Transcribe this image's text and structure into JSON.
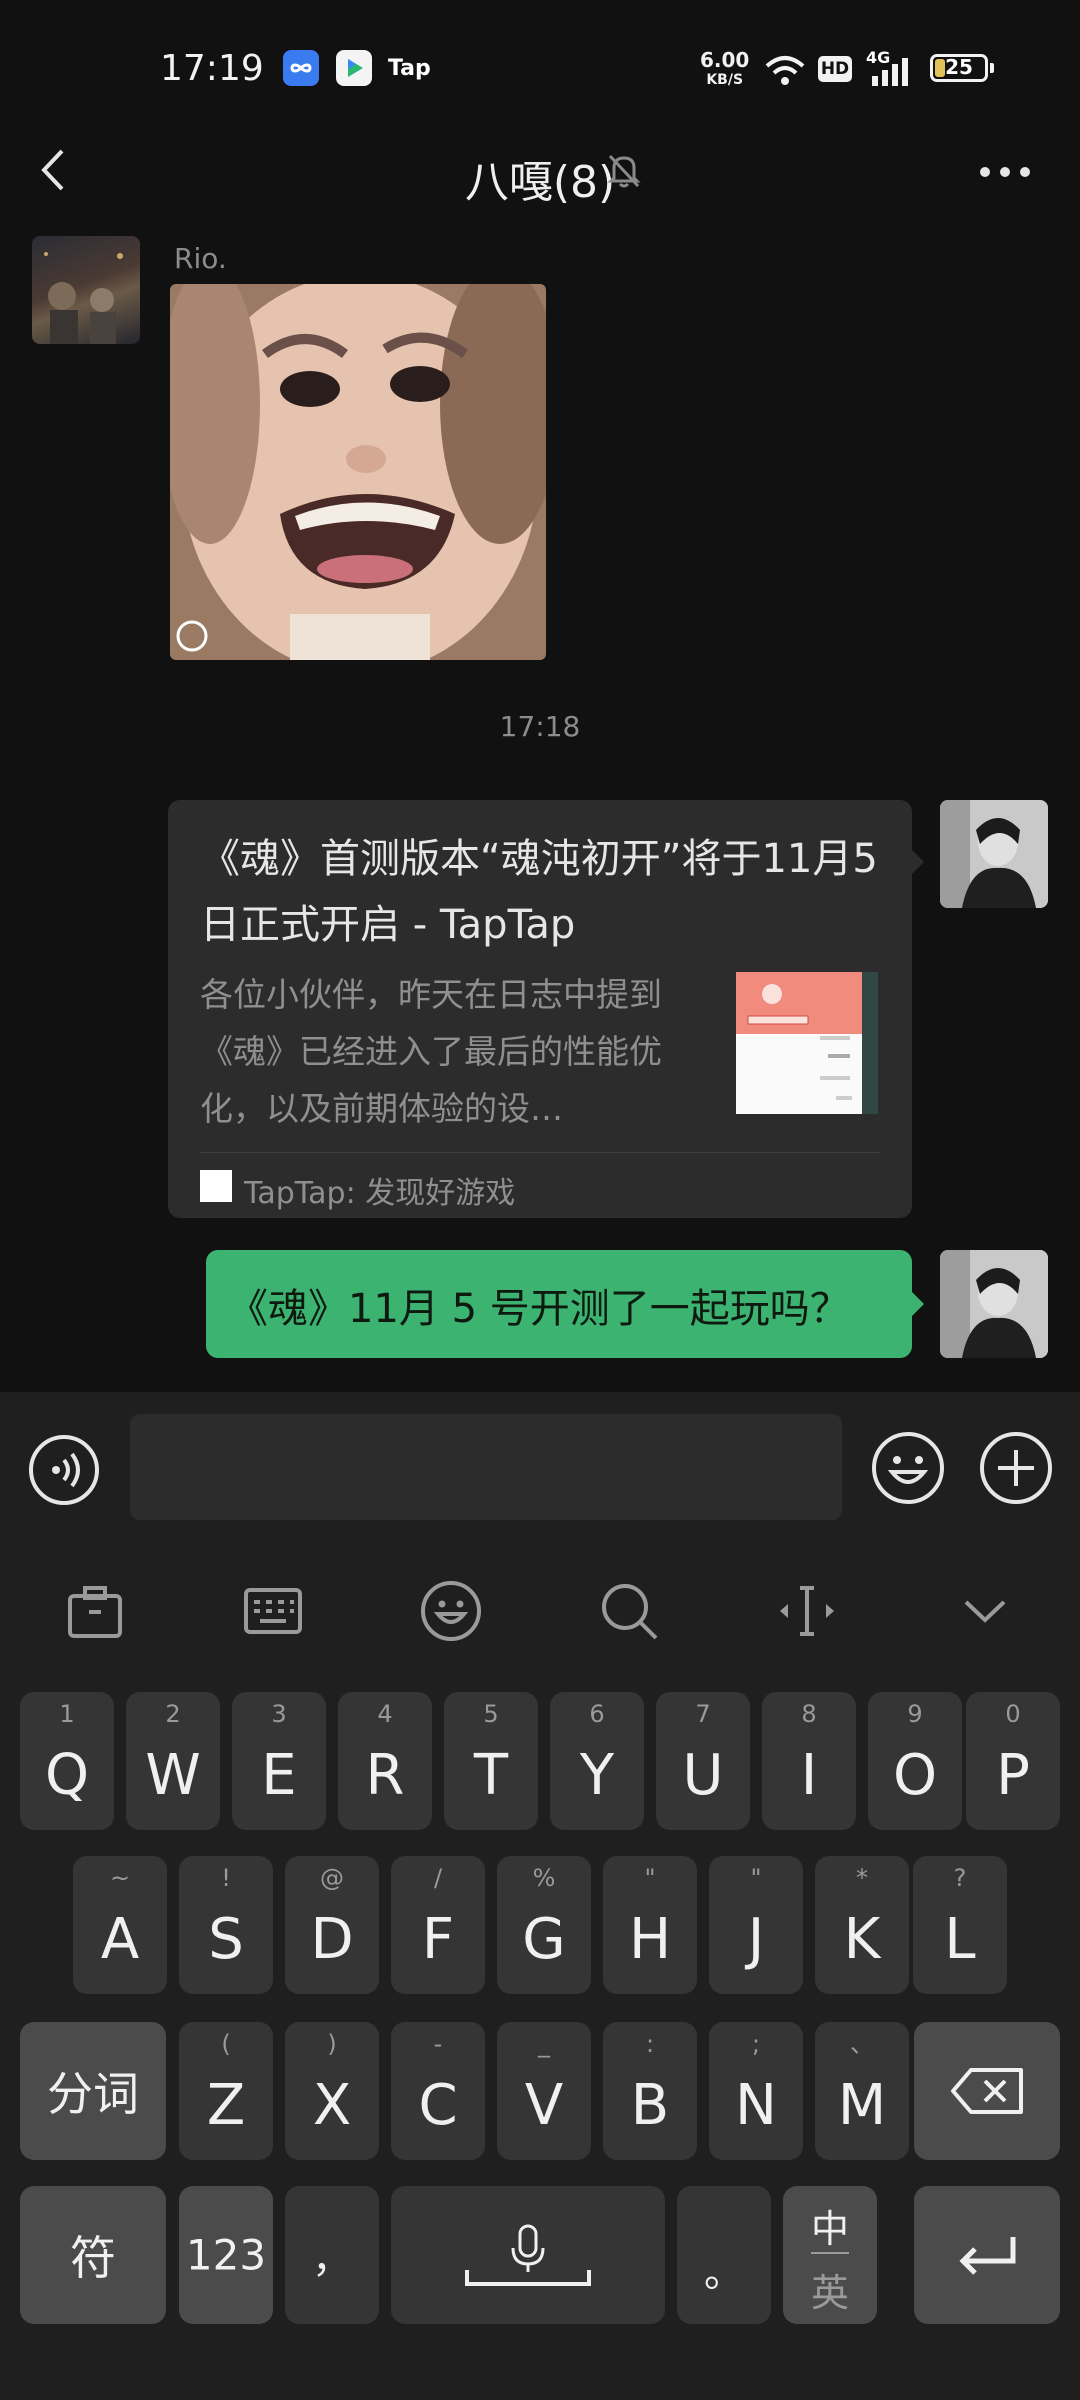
{
  "status_bar": {
    "time": "17:19",
    "app_tag": "Tap",
    "speed_value": "6.00",
    "speed_unit": "KB/S",
    "hd_label": "HD",
    "network": "4G",
    "battery": "25"
  },
  "header": {
    "title": "八嘎(8)"
  },
  "messages": {
    "sender_name": "Rio.",
    "timestamp": "17:18",
    "link_card": {
      "title": "《魂》首测版本“魂沌初开”将于11月5日正式开启 - TapTap",
      "description": "各位小伙伴，昨天在日志中提到《魂》已经进入了最后的性能优化，以及前期体验的设…",
      "source": "TapTap: 发现好游戏"
    },
    "text_message": "《魂》11月 5 号开测了一起玩吗？"
  },
  "input": {
    "placeholder": ""
  },
  "keyboard": {
    "row1": [
      {
        "hint": "1",
        "key": "Q"
      },
      {
        "hint": "2",
        "key": "W"
      },
      {
        "hint": "3",
        "key": "E"
      },
      {
        "hint": "4",
        "key": "R"
      },
      {
        "hint": "5",
        "key": "T"
      },
      {
        "hint": "6",
        "key": "Y"
      },
      {
        "hint": "7",
        "key": "U"
      },
      {
        "hint": "8",
        "key": "I"
      },
      {
        "hint": "9",
        "key": "O"
      },
      {
        "hint": "0",
        "key": "P"
      }
    ],
    "row2": [
      {
        "hint": "~",
        "key": "A"
      },
      {
        "hint": "!",
        "key": "S"
      },
      {
        "hint": "@",
        "key": "D"
      },
      {
        "hint": "/",
        "key": "F"
      },
      {
        "hint": "%",
        "key": "G"
      },
      {
        "hint": "\"",
        "key": "H"
      },
      {
        "hint": "\"",
        "key": "J"
      },
      {
        "hint": "*",
        "key": "K"
      },
      {
        "hint": "?",
        "key": "L"
      }
    ],
    "row3": [
      {
        "hint": "(",
        "key": "Z"
      },
      {
        "hint": ")",
        "key": "X"
      },
      {
        "hint": "-",
        "key": "C"
      },
      {
        "hint": "_",
        "key": "V"
      },
      {
        "hint": ":",
        "key": "B"
      },
      {
        "hint": ";",
        "key": "N"
      },
      {
        "hint": "、",
        "key": "M"
      }
    ],
    "segment_key": "分词",
    "symbol_key": "符",
    "number_key": "123",
    "comma_key": "，",
    "period_key": "。",
    "lang_key_top": "中",
    "lang_key_bottom": "英"
  },
  "colors": {
    "accent_green": "#3cb371",
    "background": "#111111"
  },
  "icons": [
    "back-icon",
    "mute-bell-icon",
    "more-icon",
    "voice-icon",
    "emoji-icon",
    "plus-icon",
    "toolbox-icon",
    "keyboard-icon",
    "smiley-icon",
    "search-icon",
    "cursor-icon",
    "collapse-icon",
    "backspace-icon",
    "mic-icon",
    "enter-icon"
  ]
}
